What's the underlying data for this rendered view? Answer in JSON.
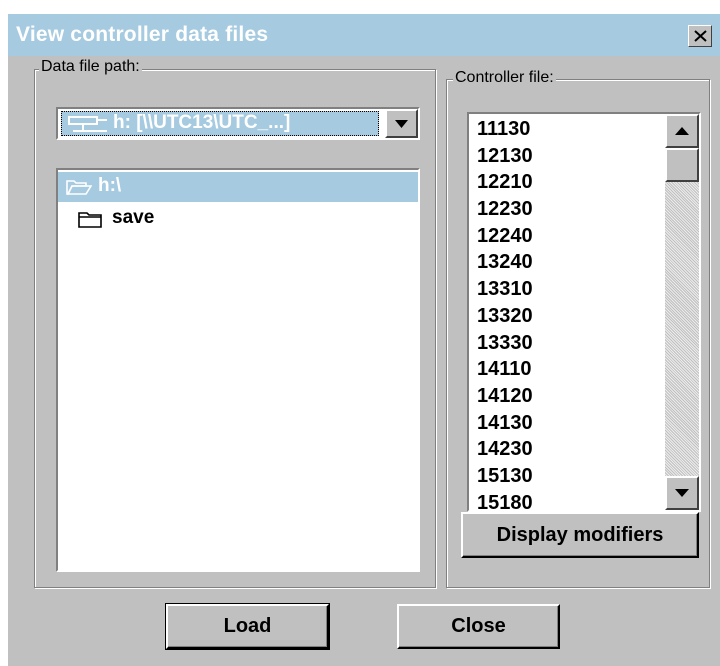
{
  "window": {
    "title": "View controller data files",
    "close_icon": "close-x-icon"
  },
  "data_path_group": {
    "label": "Data file path:",
    "drive_combo": {
      "value": "h: [\\\\UTC13\\UTC_...]",
      "icon": "network-drive-icon"
    },
    "directories": [
      {
        "name": "h:\\",
        "icon": "open-folder-icon",
        "selected": true
      },
      {
        "name": "save",
        "icon": "closed-folder-icon",
        "selected": false
      }
    ]
  },
  "controller_group": {
    "label": "Controller file:",
    "files": [
      "11130",
      "12130",
      "12210",
      "12230",
      "12240",
      "13240",
      "13310",
      "13320",
      "13330",
      "14110",
      "14120",
      "14130",
      "14230",
      "15130",
      "15180"
    ],
    "display_modifiers_label": "Display modifiers"
  },
  "buttons": {
    "load_label": "Load",
    "close_label": "Close"
  },
  "colors": {
    "title_bar": "#a6cae0",
    "selection": "#a6cae0",
    "face": "#c0c0c0"
  }
}
